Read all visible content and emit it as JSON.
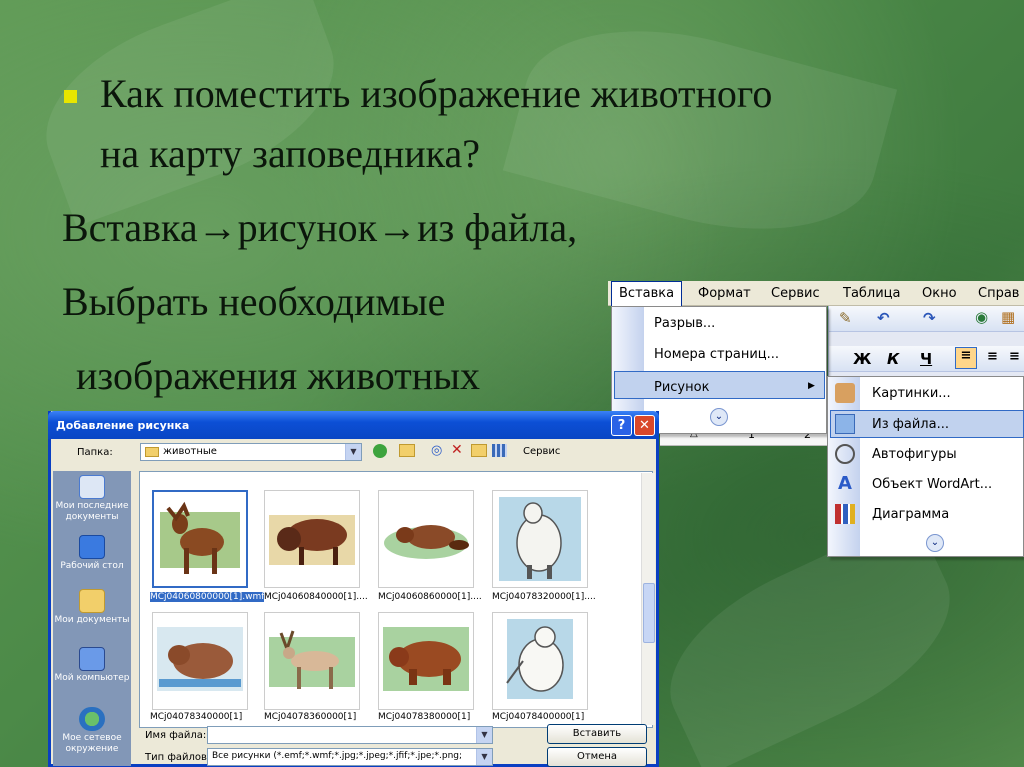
{
  "slide": {
    "bullet_line1": "Как поместить изображение животного",
    "bullet_line2": "на карту заповедника?",
    "line3": "Вставка→рисунок→из файла,",
    "line4": "Выбрать необходимые",
    "line5": "изображения животных"
  },
  "word": {
    "menubar": [
      "Вставка",
      "Формат",
      "Сервис",
      "Таблица",
      "Окно",
      "Справ"
    ],
    "insert_menu": {
      "items": [
        "Разрыв...",
        "Номера страниц...",
        "Рисунок"
      ],
      "selected": "Рисунок"
    },
    "picture_submenu": {
      "items": [
        "Картинки...",
        "Из файла...",
        "Автофигуры",
        "Объект WordArt...",
        "Диаграмма"
      ],
      "selected": "Из файла..."
    },
    "format_buttons": [
      "Ж",
      "К",
      "Ч"
    ],
    "ruler_marks": [
      "1",
      "2"
    ]
  },
  "dialog": {
    "title": "Добавление рисунка",
    "folder_label": "Папка:",
    "folder_value": "животные",
    "tools_label": "Сервис",
    "places": [
      "Мои последние документы",
      "Рабочий стол",
      "Мои документы",
      "Мой компьютер",
      "Мое сетевое окружение"
    ],
    "files": [
      "MCj04060800000[1].wmf",
      "MCj04060840000[1]....",
      "MCj04060860000[1]....",
      "MCj04078320000[1]....",
      "MCj04078340000[1]",
      "MCj04078360000[1]",
      "MCj04078380000[1]",
      "MCj04078400000[1]"
    ],
    "filename_label": "Имя файла:",
    "filename_value": "",
    "filetype_label": "Тип файлов:",
    "filetype_value": "Все рисунки (*.emf;*.wmf;*.jpg;*.jpeg;*.jfif;*.jpe;*.png;",
    "insert_button": "Вставить",
    "cancel_button": "Отмена"
  },
  "colors": {
    "bullet": "#e8e600",
    "xp_title": "#0a46c4",
    "menu_highlight": "#c1d2ee"
  }
}
